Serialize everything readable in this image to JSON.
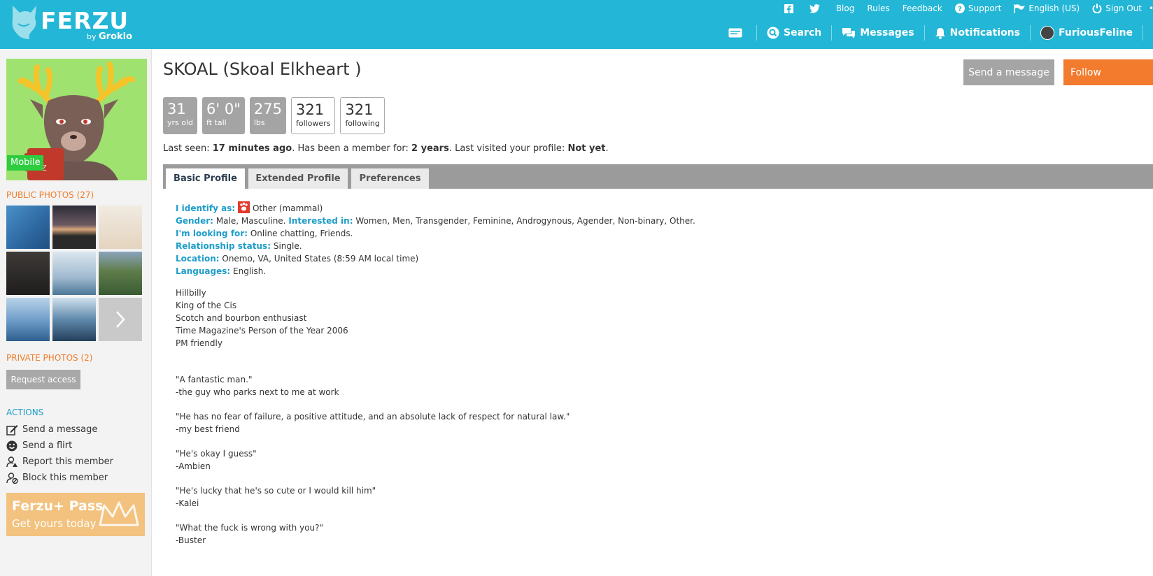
{
  "brand": {
    "name": "FERZU",
    "by_prefix": "by",
    "by_name": "Grokio"
  },
  "top_links": [
    {
      "icon": "facebook-icon",
      "label": ""
    },
    {
      "icon": "twitter-icon",
      "label": ""
    },
    {
      "icon": "",
      "label": "Blog"
    },
    {
      "icon": "",
      "label": "Rules"
    },
    {
      "icon": "",
      "label": "Feedback"
    },
    {
      "icon": "help-icon",
      "label": "Support"
    },
    {
      "icon": "flag-icon",
      "label": "English (US)"
    },
    {
      "icon": "power-icon",
      "label": "Sign Out"
    }
  ],
  "main_nav": {
    "search": "Search",
    "messages": "Messages",
    "notifications": "Notifications",
    "username": "FuriousFeline"
  },
  "sidebar": {
    "mobile_badge": "Mobile",
    "public_photos": "PUBLIC PHOTOS (27)",
    "private_photos": "PRIVATE PHOTOS (2)",
    "request_access": "Request access",
    "actions_title": "ACTIONS",
    "actions": [
      {
        "label": "Send a message",
        "icon": "edit-icon"
      },
      {
        "label": "Send a flirt",
        "icon": "smile-icon"
      },
      {
        "label": "Report this member",
        "icon": "report-user-icon"
      },
      {
        "label": "Block this member",
        "icon": "block-user-icon"
      }
    ],
    "pass": {
      "title": "Ferzu+ Pass",
      "subtitle": "Get yours today"
    }
  },
  "profile": {
    "title": "SKOAL (Skoal Elkheart )",
    "send_message": "Send a message",
    "follow": "Follow",
    "stats": [
      {
        "value": "31",
        "label": "yrs old",
        "style": "filled"
      },
      {
        "value": "6' 0\"",
        "label": "ft tall",
        "style": "filled"
      },
      {
        "value": "275",
        "label": "lbs",
        "style": "filled"
      },
      {
        "value": "321",
        "label": "followers",
        "style": "outline"
      },
      {
        "value": "321",
        "label": "following",
        "style": "outline"
      }
    ],
    "last_seen_label": "Last seen:",
    "last_seen_value": "17 minutes ago",
    "member_label": ". Has been a member for:",
    "member_value": "2 years",
    "visited_label": ". Last visited your profile:",
    "visited_value": "Not yet",
    "visited_end": "."
  },
  "tabs": [
    {
      "label": "Basic Profile",
      "active": true
    },
    {
      "label": "Extended Profile",
      "active": false
    },
    {
      "label": "Preferences",
      "active": false
    }
  ],
  "basic": {
    "identify_k": "I identify as:",
    "identify_v": "Other (mammal)",
    "gender_k": "Gender:",
    "gender_v": "Male, Masculine.",
    "interested_k": "Interested in:",
    "interested_v": "Women, Men, Transgender, Feminine, Androgynous, Agender, Non-binary, Other.",
    "looking_k": "I'm looking for:",
    "looking_v": "Online chatting, Friends.",
    "relationship_k": "Relationship status:",
    "relationship_v": "Single.",
    "location_k": "Location:",
    "location_v": "Onemo, VA, United States (8:59 AM local time)",
    "languages_k": "Languages:",
    "languages_v": "English."
  },
  "bio": [
    "Hillbilly",
    "King of the Cis",
    "Scotch and bourbon enthusiast",
    "Time Magazine's Person of the Year 2006",
    "PM friendly",
    "",
    "",
    "\"A fantastic man.\"",
    "-the guy who parks next to me at work",
    "",
    "\"He has no fear of failure, a positive attitude, and an absolute lack of respect for natural law.\"",
    "-my best friend",
    "",
    "\"He's okay I guess\"",
    "-Ambien",
    "",
    "\"He's lucky that he's so cute or I would kill him\"",
    "-Kalei",
    "",
    "\"What the fuck is wrong with you?\"",
    "-Buster"
  ]
}
